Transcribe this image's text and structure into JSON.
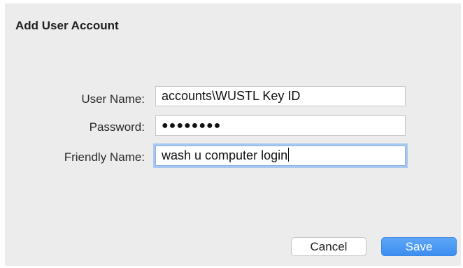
{
  "dialog": {
    "title": "Add User Account"
  },
  "form": {
    "username": {
      "label": "User Name:",
      "value": "accounts\\WUSTL Key ID"
    },
    "password": {
      "label": "Password:",
      "masked_value": "●●●●●●●●"
    },
    "friendly_name": {
      "label": "Friendly Name:",
      "value": "wash u computer login"
    }
  },
  "buttons": {
    "cancel_label": "Cancel",
    "save_label": "Save"
  },
  "colors": {
    "dialog_background": "#ececec",
    "accent": "#3b8ef0",
    "focus_ring": "#a9c8f0"
  }
}
